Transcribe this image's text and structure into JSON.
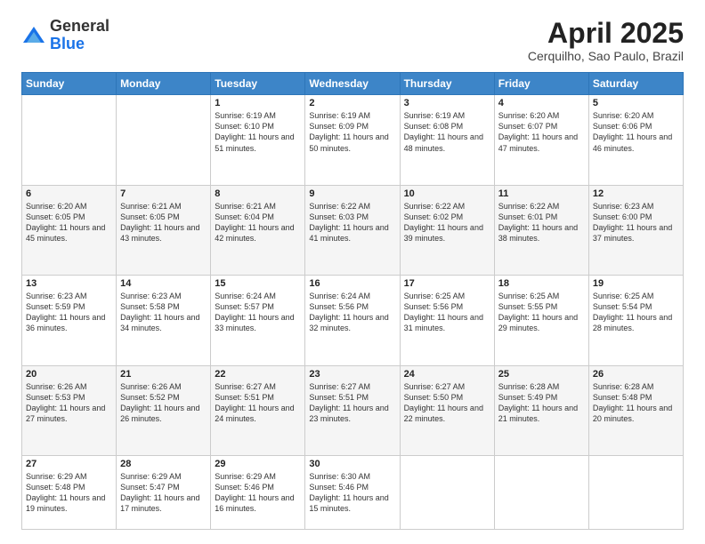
{
  "header": {
    "logo_general": "General",
    "logo_blue": "Blue",
    "title": "April 2025",
    "location": "Cerquilho, Sao Paulo, Brazil"
  },
  "days_of_week": [
    "Sunday",
    "Monday",
    "Tuesday",
    "Wednesday",
    "Thursday",
    "Friday",
    "Saturday"
  ],
  "weeks": [
    [
      {
        "day": "",
        "content": ""
      },
      {
        "day": "",
        "content": ""
      },
      {
        "day": "1",
        "content": "Sunrise: 6:19 AM\nSunset: 6:10 PM\nDaylight: 11 hours and 51 minutes."
      },
      {
        "day": "2",
        "content": "Sunrise: 6:19 AM\nSunset: 6:09 PM\nDaylight: 11 hours and 50 minutes."
      },
      {
        "day": "3",
        "content": "Sunrise: 6:19 AM\nSunset: 6:08 PM\nDaylight: 11 hours and 48 minutes."
      },
      {
        "day": "4",
        "content": "Sunrise: 6:20 AM\nSunset: 6:07 PM\nDaylight: 11 hours and 47 minutes."
      },
      {
        "day": "5",
        "content": "Sunrise: 6:20 AM\nSunset: 6:06 PM\nDaylight: 11 hours and 46 minutes."
      }
    ],
    [
      {
        "day": "6",
        "content": "Sunrise: 6:20 AM\nSunset: 6:05 PM\nDaylight: 11 hours and 45 minutes."
      },
      {
        "day": "7",
        "content": "Sunrise: 6:21 AM\nSunset: 6:05 PM\nDaylight: 11 hours and 43 minutes."
      },
      {
        "day": "8",
        "content": "Sunrise: 6:21 AM\nSunset: 6:04 PM\nDaylight: 11 hours and 42 minutes."
      },
      {
        "day": "9",
        "content": "Sunrise: 6:22 AM\nSunset: 6:03 PM\nDaylight: 11 hours and 41 minutes."
      },
      {
        "day": "10",
        "content": "Sunrise: 6:22 AM\nSunset: 6:02 PM\nDaylight: 11 hours and 39 minutes."
      },
      {
        "day": "11",
        "content": "Sunrise: 6:22 AM\nSunset: 6:01 PM\nDaylight: 11 hours and 38 minutes."
      },
      {
        "day": "12",
        "content": "Sunrise: 6:23 AM\nSunset: 6:00 PM\nDaylight: 11 hours and 37 minutes."
      }
    ],
    [
      {
        "day": "13",
        "content": "Sunrise: 6:23 AM\nSunset: 5:59 PM\nDaylight: 11 hours and 36 minutes."
      },
      {
        "day": "14",
        "content": "Sunrise: 6:23 AM\nSunset: 5:58 PM\nDaylight: 11 hours and 34 minutes."
      },
      {
        "day": "15",
        "content": "Sunrise: 6:24 AM\nSunset: 5:57 PM\nDaylight: 11 hours and 33 minutes."
      },
      {
        "day": "16",
        "content": "Sunrise: 6:24 AM\nSunset: 5:56 PM\nDaylight: 11 hours and 32 minutes."
      },
      {
        "day": "17",
        "content": "Sunrise: 6:25 AM\nSunset: 5:56 PM\nDaylight: 11 hours and 31 minutes."
      },
      {
        "day": "18",
        "content": "Sunrise: 6:25 AM\nSunset: 5:55 PM\nDaylight: 11 hours and 29 minutes."
      },
      {
        "day": "19",
        "content": "Sunrise: 6:25 AM\nSunset: 5:54 PM\nDaylight: 11 hours and 28 minutes."
      }
    ],
    [
      {
        "day": "20",
        "content": "Sunrise: 6:26 AM\nSunset: 5:53 PM\nDaylight: 11 hours and 27 minutes."
      },
      {
        "day": "21",
        "content": "Sunrise: 6:26 AM\nSunset: 5:52 PM\nDaylight: 11 hours and 26 minutes."
      },
      {
        "day": "22",
        "content": "Sunrise: 6:27 AM\nSunset: 5:51 PM\nDaylight: 11 hours and 24 minutes."
      },
      {
        "day": "23",
        "content": "Sunrise: 6:27 AM\nSunset: 5:51 PM\nDaylight: 11 hours and 23 minutes."
      },
      {
        "day": "24",
        "content": "Sunrise: 6:27 AM\nSunset: 5:50 PM\nDaylight: 11 hours and 22 minutes."
      },
      {
        "day": "25",
        "content": "Sunrise: 6:28 AM\nSunset: 5:49 PM\nDaylight: 11 hours and 21 minutes."
      },
      {
        "day": "26",
        "content": "Sunrise: 6:28 AM\nSunset: 5:48 PM\nDaylight: 11 hours and 20 minutes."
      }
    ],
    [
      {
        "day": "27",
        "content": "Sunrise: 6:29 AM\nSunset: 5:48 PM\nDaylight: 11 hours and 19 minutes."
      },
      {
        "day": "28",
        "content": "Sunrise: 6:29 AM\nSunset: 5:47 PM\nDaylight: 11 hours and 17 minutes."
      },
      {
        "day": "29",
        "content": "Sunrise: 6:29 AM\nSunset: 5:46 PM\nDaylight: 11 hours and 16 minutes."
      },
      {
        "day": "30",
        "content": "Sunrise: 6:30 AM\nSunset: 5:46 PM\nDaylight: 11 hours and 15 minutes."
      },
      {
        "day": "",
        "content": ""
      },
      {
        "day": "",
        "content": ""
      },
      {
        "day": "",
        "content": ""
      }
    ]
  ]
}
